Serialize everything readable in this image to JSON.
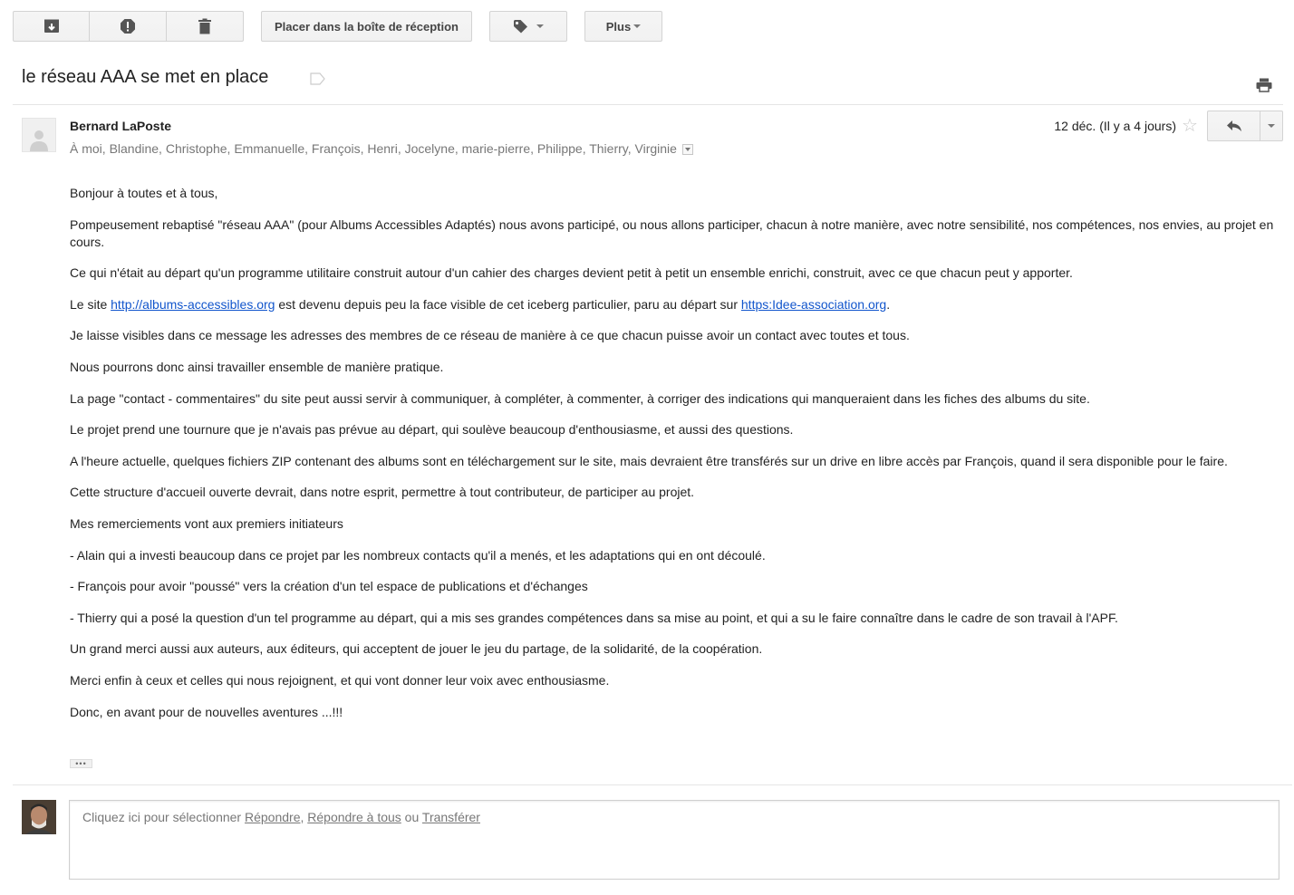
{
  "toolbar": {
    "archive_icon": "archive-icon",
    "spam_icon": "report-spam-icon",
    "delete_icon": "trash-icon",
    "move_to_inbox": "Placer dans la boîte de réception",
    "labels_icon": "label-icon",
    "more": "Plus"
  },
  "subject": "le réseau AAA se met en place",
  "message": {
    "sender": "Bernard LaPoste",
    "recipients": "À moi, Blandine, Christophe, Emmanuelle, François, Henri, Jocelyne, marie-pierre, Philippe, Thierry, Virginie",
    "date": "12 déc. (Il y a 4 jours)",
    "body": {
      "p1": "Bonjour à toutes et à tous,",
      "p2": "Pompeusement rebaptisé \"réseau AAA\" (pour Albums Accessibles Adaptés) nous avons participé, ou nous allons participer, chacun à notre manière, avec notre sensibilité, nos compétences, nos envies, au projet en cours.",
      "p3": "Ce qui n'était au départ qu'un programme utilitaire construit autour d'un cahier des charges devient petit à petit un ensemble enrichi, construit, avec ce que chacun peut y apporter.",
      "p4_a": "Le site ",
      "p4_link1": "http://albums-accessibles.org",
      "p4_b": " est devenu depuis peu la face visible de cet iceberg particulier, paru au départ sur ",
      "p4_link2": "https:Idee-association.org",
      "p4_c": ".",
      "p5": "Je laisse visibles dans ce message les adresses des membres de ce réseau de manière à ce que chacun puisse avoir un contact avec toutes et tous.",
      "p6": "Nous pourrons donc ainsi travailler ensemble de manière pratique.",
      "p7": "La page \"contact - commentaires\" du site peut aussi servir à communiquer, à compléter, à commenter, à corriger des indications qui manqueraient dans les fiches des albums du site.",
      "p8": "Le projet prend une tournure que je n'avais pas prévue au départ, qui soulève beaucoup d'enthousiasme, et aussi des questions.",
      "p9": "A l'heure actuelle, quelques fichiers ZIP contenant des albums sont en téléchargement sur le site, mais devraient être transférés sur un drive en libre accès par François, quand il sera disponible pour le faire.",
      "p10": "Cette structure d'accueil ouverte devrait, dans notre esprit, permettre à tout contributeur, de participer au projet.",
      "p11": "Mes remerciements vont aux premiers initiateurs",
      "p12": "- Alain qui a investi beaucoup dans ce projet par les nombreux contacts qu'il a menés, et les adaptations qui en ont découlé.",
      "p13": "- François pour avoir \"poussé\" vers la création d'un tel espace de publications et d'échanges",
      "p14": "- Thierry qui a posé la question d'un tel programme au départ, qui a mis ses grandes compétences dans sa mise au point, et qui a su le faire connaître dans le cadre de son travail à l'APF.",
      "p15": "Un grand merci aussi aux auteurs, aux éditeurs, qui acceptent de jouer le jeu du partage, de la solidarité, de la coopération.",
      "p16": "Merci enfin à ceux et celles qui nous rejoignent, et qui vont donner leur voix avec enthousiasme.",
      "p17": "Donc, en avant pour de nouvelles aventures ...!!!"
    },
    "ellipsis": "•••"
  },
  "reply": {
    "prefix": "Cliquez ici pour sélectionner ",
    "reply": "Répondre",
    "sep": ", ",
    "reply_all": "Répondre à tous",
    "or": " ou ",
    "forward": "Transférer"
  },
  "colors": {
    "link": "#1155cc",
    "muted": "#777777",
    "button_bg": "#f5f5f5"
  }
}
